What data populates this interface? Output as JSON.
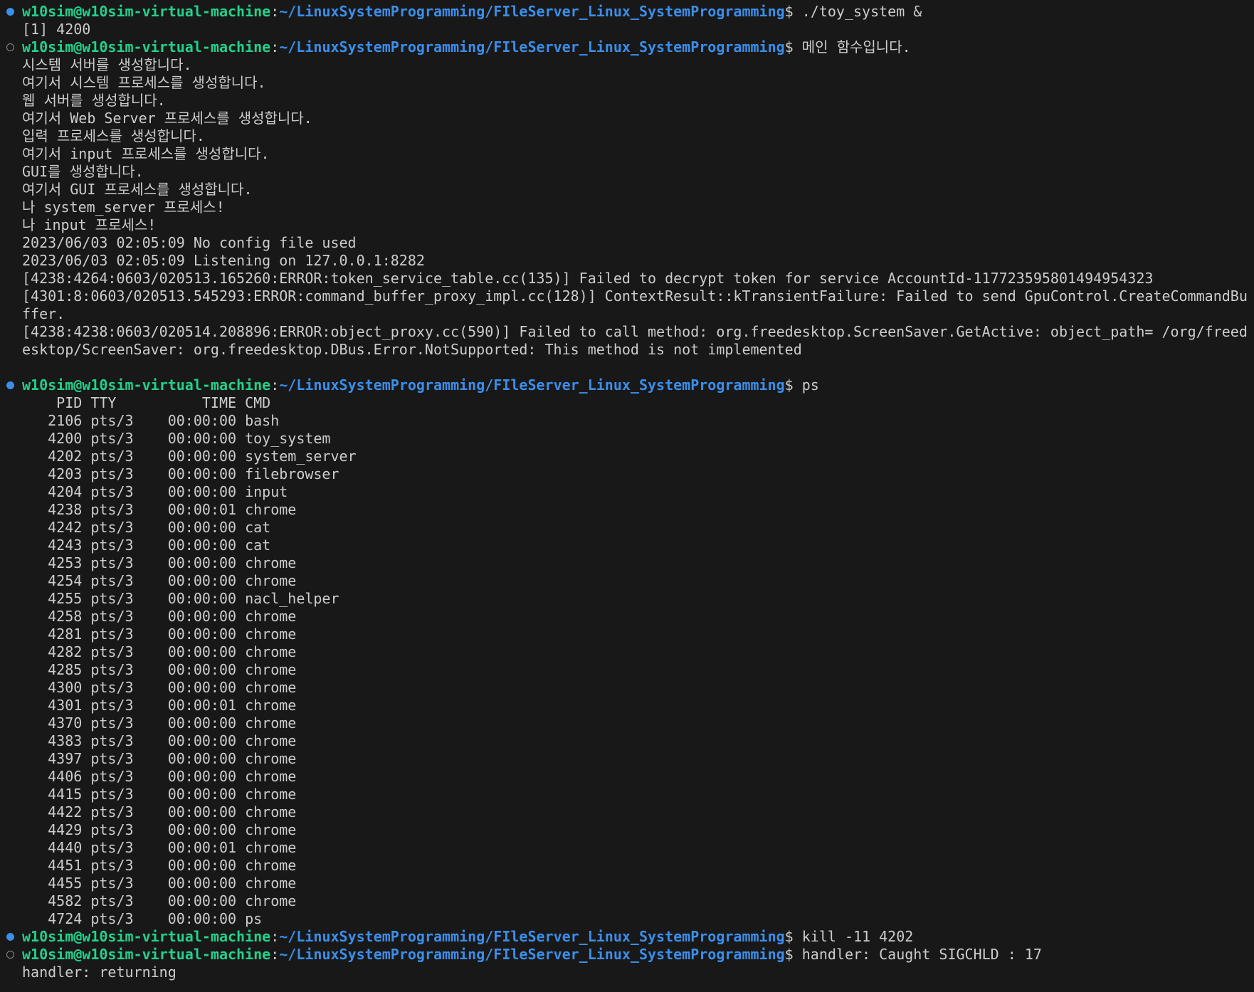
{
  "colors": {
    "background": "#181818",
    "text": "#cccccc",
    "prompt_user": "#23d18b",
    "prompt_path": "#3b8eea",
    "dot_filled": "#3b8eea",
    "dot_hollow": "#8a8a8a"
  },
  "prompt": {
    "user": "w10sim@w10sim-virtual-machine",
    "sep": ":",
    "path": "~/LinuxSystemProgramming/FIleServer_Linux_SystemProgramming",
    "symbol": "$ "
  },
  "lines": [
    {
      "type": "prompt",
      "dot": "filled",
      "text": "./toy_system &"
    },
    {
      "type": "output",
      "text": "[1] 4200"
    },
    {
      "type": "prompt",
      "dot": "hollow",
      "text": "메인 함수입니다."
    },
    {
      "type": "output",
      "text": "시스템 서버를 생성합니다."
    },
    {
      "type": "output",
      "text": "여기서 시스템 프로세스를 생성합니다."
    },
    {
      "type": "output",
      "text": "웹 서버를 생성합니다."
    },
    {
      "type": "output",
      "text": "여기서 Web Server 프로세스를 생성합니다."
    },
    {
      "type": "output",
      "text": "입력 프로세스를 생성합니다."
    },
    {
      "type": "output",
      "text": "여기서 input 프로세스를 생성합니다."
    },
    {
      "type": "output",
      "text": "GUI를 생성합니다."
    },
    {
      "type": "output",
      "text": "여기서 GUI 프로세스를 생성합니다."
    },
    {
      "type": "output",
      "text": "나 system_server 프로세스!"
    },
    {
      "type": "output",
      "text": "나 input 프로세스!"
    },
    {
      "type": "output",
      "text": "2023/06/03 02:05:09 No config file used"
    },
    {
      "type": "output",
      "text": "2023/06/03 02:05:09 Listening on 127.0.0.1:8282"
    },
    {
      "type": "output",
      "text": "[4238:4264:0603/020513.165260:ERROR:token_service_table.cc(135)] Failed to decrypt token for service AccountId-117723595801494954323"
    },
    {
      "type": "output",
      "text": "[4301:8:0603/020513.545293:ERROR:command_buffer_proxy_impl.cc(128)] ContextResult::kTransientFailure: Failed to send GpuControl.CreateCommandBu"
    },
    {
      "type": "output",
      "text": "ffer."
    },
    {
      "type": "output",
      "text": "[4238:4238:0603/020514.208896:ERROR:object_proxy.cc(590)] Failed to call method: org.freedesktop.ScreenSaver.GetActive: object_path= /org/freed"
    },
    {
      "type": "output",
      "text": "esktop/ScreenSaver: org.freedesktop.DBus.Error.NotSupported: This method is not implemented"
    },
    {
      "type": "output",
      "text": ""
    },
    {
      "type": "prompt",
      "dot": "filled",
      "text": "ps"
    },
    {
      "type": "output",
      "text": "    PID TTY          TIME CMD"
    },
    {
      "type": "output",
      "text": "   2106 pts/3    00:00:00 bash"
    },
    {
      "type": "output",
      "text": "   4200 pts/3    00:00:00 toy_system"
    },
    {
      "type": "output",
      "text": "   4202 pts/3    00:00:00 system_server"
    },
    {
      "type": "output",
      "text": "   4203 pts/3    00:00:00 filebrowser"
    },
    {
      "type": "output",
      "text": "   4204 pts/3    00:00:00 input"
    },
    {
      "type": "output",
      "text": "   4238 pts/3    00:00:01 chrome"
    },
    {
      "type": "output",
      "text": "   4242 pts/3    00:00:00 cat"
    },
    {
      "type": "output",
      "text": "   4243 pts/3    00:00:00 cat"
    },
    {
      "type": "output",
      "text": "   4253 pts/3    00:00:00 chrome"
    },
    {
      "type": "output",
      "text": "   4254 pts/3    00:00:00 chrome"
    },
    {
      "type": "output",
      "text": "   4255 pts/3    00:00:00 nacl_helper"
    },
    {
      "type": "output",
      "text": "   4258 pts/3    00:00:00 chrome"
    },
    {
      "type": "output",
      "text": "   4281 pts/3    00:00:00 chrome"
    },
    {
      "type": "output",
      "text": "   4282 pts/3    00:00:00 chrome"
    },
    {
      "type": "output",
      "text": "   4285 pts/3    00:00:00 chrome"
    },
    {
      "type": "output",
      "text": "   4300 pts/3    00:00:00 chrome"
    },
    {
      "type": "output",
      "text": "   4301 pts/3    00:00:01 chrome"
    },
    {
      "type": "output",
      "text": "   4370 pts/3    00:00:00 chrome"
    },
    {
      "type": "output",
      "text": "   4383 pts/3    00:00:00 chrome"
    },
    {
      "type": "output",
      "text": "   4397 pts/3    00:00:00 chrome"
    },
    {
      "type": "output",
      "text": "   4406 pts/3    00:00:00 chrome"
    },
    {
      "type": "output",
      "text": "   4415 pts/3    00:00:00 chrome"
    },
    {
      "type": "output",
      "text": "   4422 pts/3    00:00:00 chrome"
    },
    {
      "type": "output",
      "text": "   4429 pts/3    00:00:00 chrome"
    },
    {
      "type": "output",
      "text": "   4440 pts/3    00:00:01 chrome"
    },
    {
      "type": "output",
      "text": "   4451 pts/3    00:00:00 chrome"
    },
    {
      "type": "output",
      "text": "   4455 pts/3    00:00:00 chrome"
    },
    {
      "type": "output",
      "text": "   4582 pts/3    00:00:00 chrome"
    },
    {
      "type": "output",
      "text": "   4724 pts/3    00:00:00 ps"
    },
    {
      "type": "prompt",
      "dot": "filled",
      "text": "kill -11 4202"
    },
    {
      "type": "prompt",
      "dot": "hollow",
      "text": "handler: Caught SIGCHLD : 17"
    },
    {
      "type": "output",
      "text": "handler: returning"
    }
  ]
}
